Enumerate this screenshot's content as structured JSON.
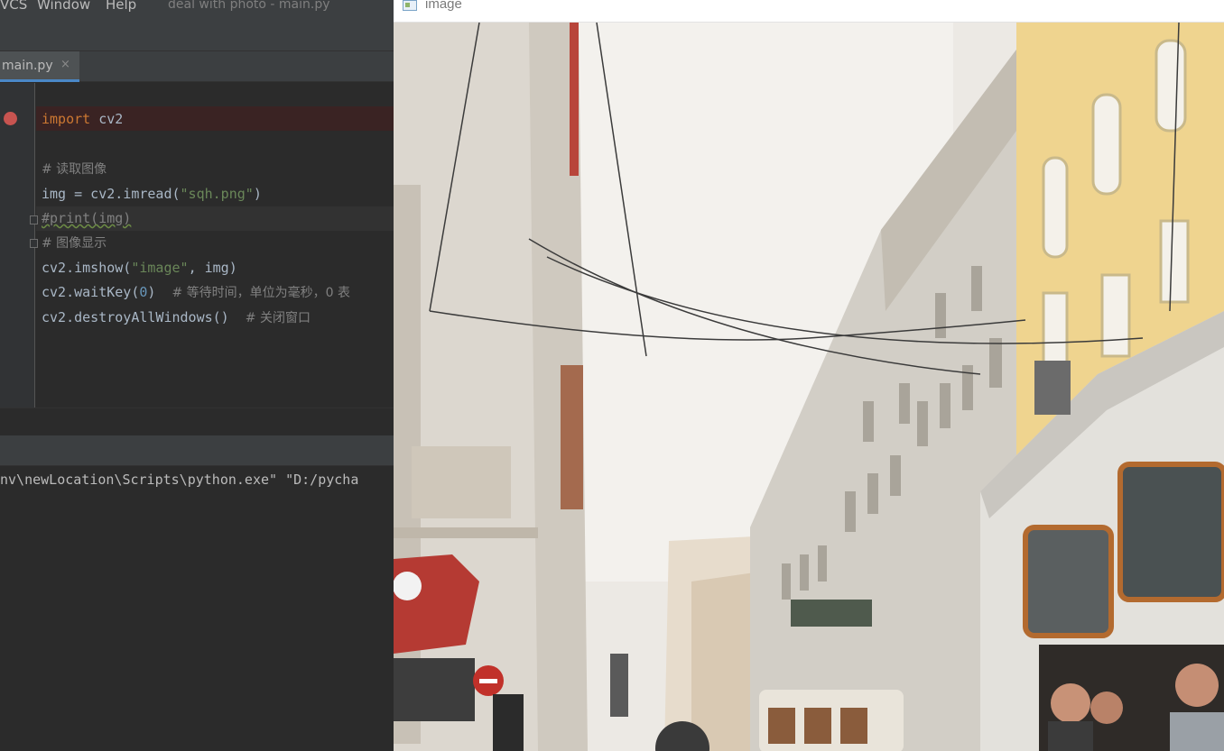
{
  "ide": {
    "menu": [
      "VCS",
      "Window",
      "Help"
    ],
    "window_title": "deal with photo - main.py",
    "tab": {
      "label": "main.py",
      "close": "×"
    },
    "code": {
      "l1_kw": "import",
      "l1_rest": " cv2",
      "l2": "# 读取图像",
      "l3_a": "img = cv2.imread(",
      "l3_str": "\"sqh.png\"",
      "l3_b": ")",
      "l4": "#print(img)",
      "l5": "# 图像显示",
      "l6_a": "cv2.imshow(",
      "l6_str": "\"image\"",
      "l6_b": ", img)",
      "l7_a": "cv2.waitKey(",
      "l7_num": "0",
      "l7_b": ")  ",
      "l7_cmt": "# 等待时间，单位为毫秒，0 表",
      "l8_a": "cv2.destroyAllWindows()  ",
      "l8_cmt": "# 关闭窗口"
    },
    "console_line": "nv\\newLocation\\Scripts\\python.exe\" \"D:/pycha"
  },
  "image_window": {
    "title": "image",
    "photo_subject": "street-scene-with-tram"
  },
  "colors": {
    "ide_bg": "#2b2b2b",
    "keyword": "#cc7832",
    "string": "#6a8759",
    "number": "#6897bb",
    "comment": "#808080",
    "breakpoint": "#c75450",
    "tab_accent": "#4a88c7"
  }
}
